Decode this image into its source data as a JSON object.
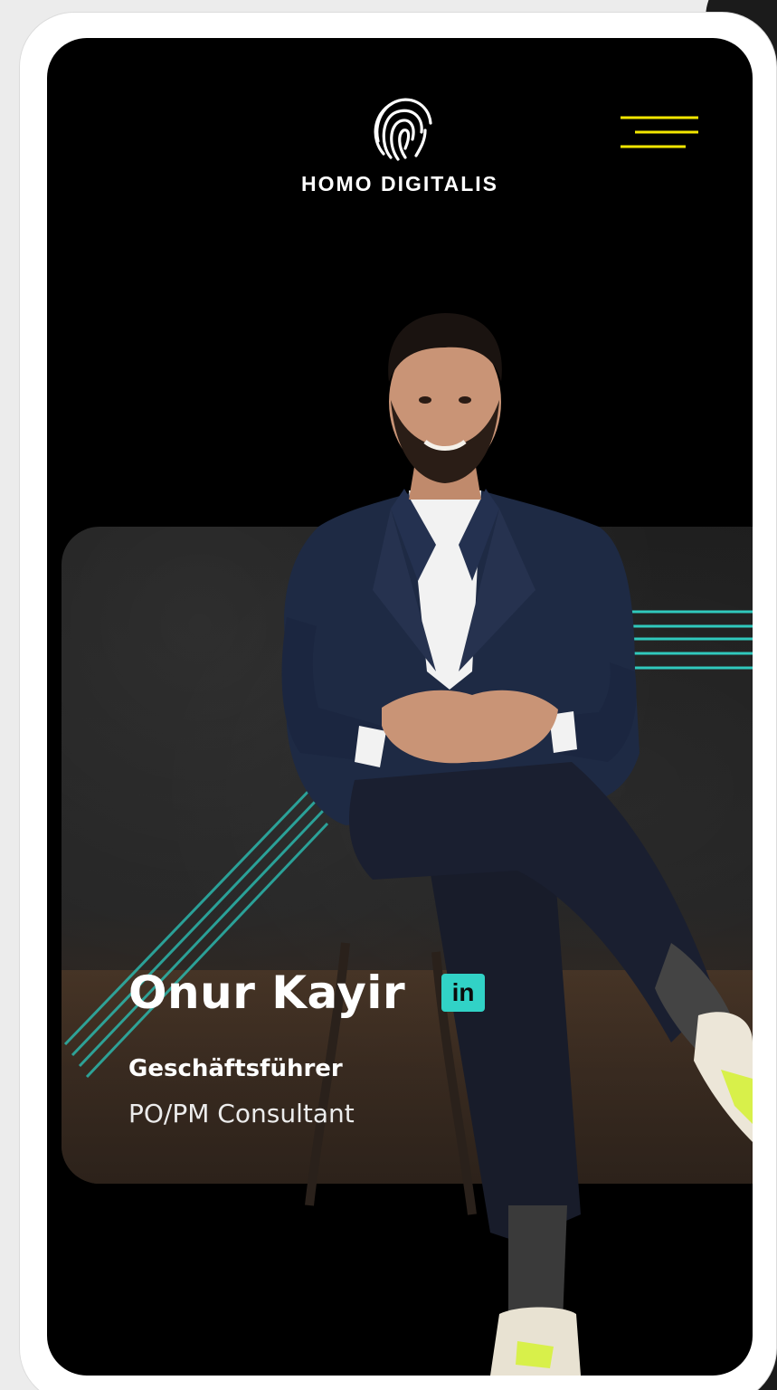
{
  "brand": {
    "name": "HOMO DIGITALIS",
    "logo_icon": "fingerprint-icon"
  },
  "header": {
    "menu_icon": "hamburger-menu-icon",
    "menu_color": "#f2e600"
  },
  "profile": {
    "name": "Onur Kayir",
    "linkedin_label": "in",
    "title": "Geschäftsführer",
    "subtitle": "PO/PM Consultant"
  },
  "colors": {
    "accent_teal": "#31d2c6",
    "background": "#000000"
  }
}
